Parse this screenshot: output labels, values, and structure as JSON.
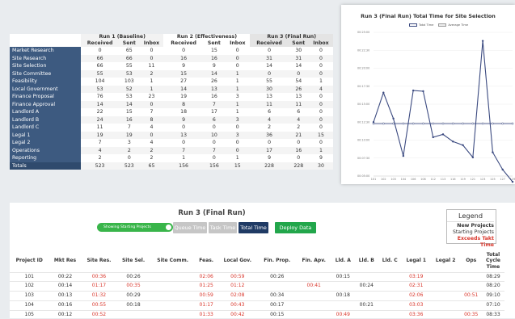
{
  "summary": {
    "groups": [
      "Run 1 (Baseline)",
      "Run 2 (Effectiveness)",
      "Run 3 (Final Run)"
    ],
    "subheaders": [
      "Received",
      "Sent",
      "Inbox"
    ],
    "rows": [
      {
        "label": "Market Research",
        "v": [
          "0",
          "65",
          "0",
          "0",
          "15",
          "0",
          "0",
          "30",
          "0"
        ]
      },
      {
        "label": "Site Research",
        "v": [
          "66",
          "66",
          "0",
          "16",
          "16",
          "0",
          "31",
          "31",
          "0"
        ]
      },
      {
        "label": "Site Selection",
        "v": [
          "66",
          "55",
          "11",
          "9",
          "9",
          "0",
          "14",
          "14",
          "0"
        ]
      },
      {
        "label": "Site Committee",
        "v": [
          "55",
          "53",
          "2",
          "15",
          "14",
          "1",
          "0",
          "0",
          "0"
        ]
      },
      {
        "label": "Feasibility",
        "v": [
          "104",
          "103",
          "1",
          "27",
          "26",
          "1",
          "55",
          "54",
          "1"
        ]
      },
      {
        "label": "Local Government",
        "v": [
          "53",
          "52",
          "1",
          "14",
          "13",
          "1",
          "30",
          "26",
          "4"
        ]
      },
      {
        "label": "Finance Proposal",
        "v": [
          "76",
          "53",
          "23",
          "19",
          "16",
          "3",
          "13",
          "13",
          "0"
        ]
      },
      {
        "label": "Finance Approval",
        "v": [
          "14",
          "14",
          "0",
          "8",
          "7",
          "1",
          "11",
          "11",
          "0"
        ]
      },
      {
        "label": "Landlord A",
        "v": [
          "22",
          "15",
          "7",
          "18",
          "17",
          "1",
          "6",
          "6",
          "0"
        ]
      },
      {
        "label": "Landlord B",
        "v": [
          "24",
          "16",
          "8",
          "9",
          "6",
          "3",
          "4",
          "4",
          "0"
        ]
      },
      {
        "label": "Landlord C",
        "v": [
          "11",
          "7",
          "4",
          "0",
          "0",
          "0",
          "2",
          "2",
          "0"
        ]
      },
      {
        "label": "Legal 1",
        "v": [
          "19",
          "19",
          "0",
          "13",
          "10",
          "3",
          "36",
          "21",
          "15"
        ]
      },
      {
        "label": "Legal 2",
        "v": [
          "7",
          "3",
          "4",
          "0",
          "0",
          "0",
          "0",
          "0",
          "0"
        ]
      },
      {
        "label": "Operations",
        "v": [
          "4",
          "2",
          "2",
          "7",
          "7",
          "0",
          "17",
          "16",
          "1"
        ]
      },
      {
        "label": "Reporting",
        "v": [
          "2",
          "0",
          "2",
          "1",
          "0",
          "1",
          "9",
          "0",
          "9"
        ]
      },
      {
        "label": "Totals",
        "v": [
          "523",
          "523",
          "65",
          "156",
          "156",
          "15",
          "228",
          "228",
          "30"
        ]
      }
    ]
  },
  "chart": {
    "title": "Run 3 (Final Run) Total Time for Site Selection",
    "legend": [
      "Total Time",
      "Average Time"
    ]
  },
  "chart_data": {
    "type": "line",
    "title": "Run 3 (Final Run) Total Time for Site Selection",
    "ylabels": [
      "00:25:00",
      "00:22:30",
      "00:20:00",
      "00:17:30",
      "00:15:00",
      "00:12:30",
      "00:10:00",
      "00:07:30",
      "00:05:00"
    ],
    "categories": [
      "101",
      "102",
      "103",
      "104",
      "106",
      "108",
      "112",
      "113",
      "116",
      "119",
      "121",
      "123",
      "125",
      "127",
      "129"
    ],
    "series": [
      {
        "name": "Total Time",
        "values": [
          12.5,
          16.6,
          13.0,
          7.8,
          16.9,
          16.8,
          10.4,
          10.8,
          9.8,
          9.3,
          7.6,
          23.8,
          8.3,
          5.9,
          4.2
        ]
      },
      {
        "name": "Average Time",
        "values": [
          12.3,
          12.3,
          12.3,
          12.3,
          12.3,
          12.3,
          12.3,
          12.3,
          12.3,
          12.3,
          12.3,
          12.3,
          12.3,
          12.3,
          12.3
        ]
      }
    ],
    "ylim": [
      5,
      25
    ],
    "colors": {
      "total": "#3b4a80",
      "average": "#999999"
    }
  },
  "panel": {
    "title": "Run 3 (Final Run)",
    "toggle_label": "Showing Starting Projects",
    "buttons": {
      "queue": "Queue Time",
      "task": "Task Time",
      "total": "Total Time",
      "deploy": "Deploy Data"
    },
    "legend": {
      "title": "Legend",
      "new": "New Projects",
      "starting": "Starting Projects",
      "exceeds": "Exceeds Takt Time"
    },
    "headers": [
      "Project ID",
      "Mkt Res",
      "Site Res.",
      "Site Sel.",
      "Site Comm.",
      "Feas.",
      "Local Gov.",
      "Fin. Prop.",
      "Fin. Apv.",
      "Lld. A",
      "Lld. B",
      "Lld. C",
      "Legal 1",
      "Legal 2",
      "Ops",
      "Total Cycle Time"
    ],
    "rows": [
      [
        "101",
        "00:22",
        "00:36",
        "00:26",
        "",
        "02:06",
        "00:59",
        "00:26",
        "",
        "00:15",
        "",
        "",
        "03:19",
        "",
        "",
        "08:29"
      ],
      [
        "102",
        "00:14",
        "01:17",
        "00:35",
        "",
        "01:25",
        "01:12",
        "",
        "00:41",
        "",
        "00:24",
        "",
        "02:31",
        "",
        "",
        "08:20"
      ],
      [
        "103",
        "00:13",
        "01:32",
        "00:29",
        "",
        "00:59",
        "02:08",
        "00:34",
        "",
        "00:18",
        "",
        "",
        "02:06",
        "",
        "00:51",
        "09:10"
      ],
      [
        "104",
        "00:16",
        "00:55",
        "00:18",
        "",
        "01:17",
        "00:43",
        "00:17",
        "",
        "",
        "00:21",
        "",
        "03:03",
        "",
        "",
        "07:10"
      ],
      [
        "105",
        "00:12",
        "00:52",
        "",
        "",
        "01:33",
        "00:42",
        "00:15",
        "",
        "00:49",
        "",
        "",
        "03:36",
        "",
        "00:35",
        "08:33"
      ]
    ],
    "red": [
      [
        false,
        false,
        true,
        false,
        false,
        true,
        true,
        false,
        false,
        false,
        false,
        false,
        true,
        false,
        false,
        false
      ],
      [
        false,
        false,
        true,
        true,
        false,
        true,
        true,
        false,
        true,
        false,
        false,
        false,
        true,
        false,
        false,
        false
      ],
      [
        false,
        false,
        true,
        false,
        false,
        true,
        true,
        false,
        false,
        false,
        false,
        false,
        true,
        false,
        true,
        false
      ],
      [
        false,
        false,
        true,
        false,
        false,
        true,
        true,
        false,
        false,
        false,
        false,
        false,
        true,
        false,
        false,
        false
      ],
      [
        false,
        false,
        true,
        false,
        false,
        true,
        true,
        false,
        false,
        true,
        false,
        false,
        true,
        false,
        true,
        false
      ]
    ]
  }
}
